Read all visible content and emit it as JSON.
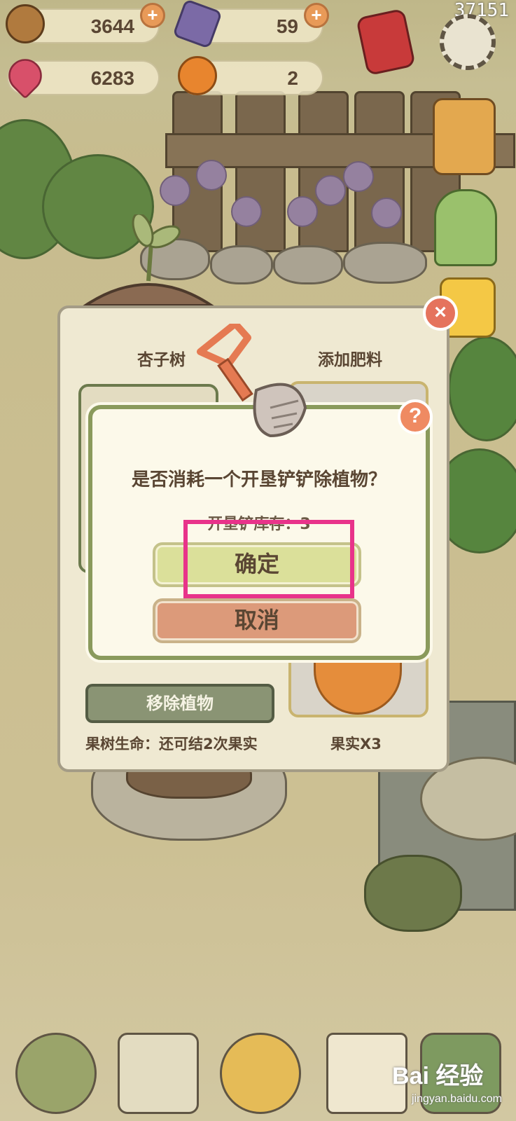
{
  "topbar": {
    "id_text": "37151",
    "acorns": "3644",
    "gems": "59",
    "hearts": "6283",
    "oranges": "2"
  },
  "panel": {
    "tree_title": "杏子树",
    "fertilizer_title": "添加肥料",
    "remove_label": "移除植物",
    "life_text": "果树生命：还可结2次果实",
    "fruit_text": "果实X3"
  },
  "dialog": {
    "question": "是否消耗一个开垦铲铲除植物？",
    "stock": "开垦铲库存：3",
    "confirm": "确定",
    "cancel": "取消"
  },
  "colors": {
    "highlight": "#e8338a",
    "confirm_bg": "#dbe09a",
    "cancel_bg": "#dc9a7a"
  },
  "watermark": {
    "brand": "Bai 经验",
    "url": "jingyan.baidu.com"
  }
}
